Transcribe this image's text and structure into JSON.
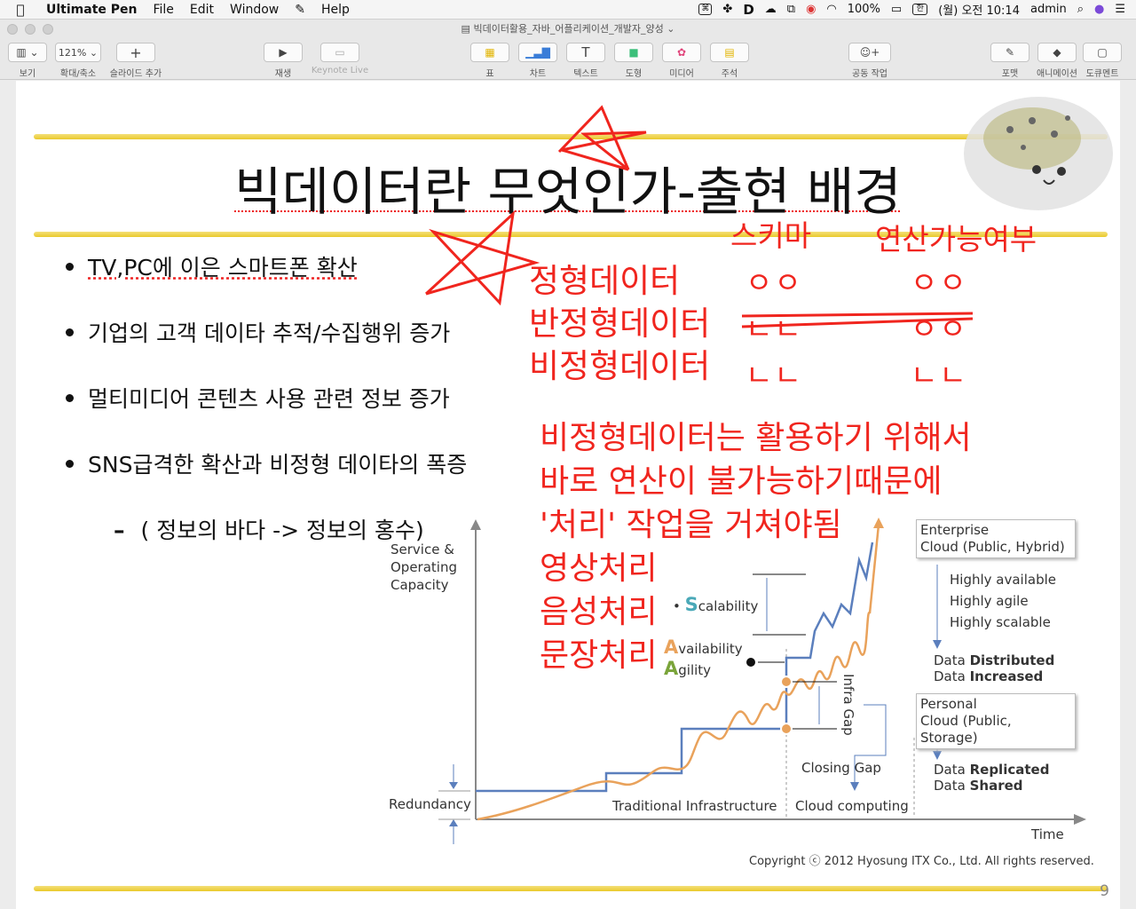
{
  "menubar": {
    "app_name": "Ultimate Pen",
    "menus": [
      "File",
      "Edit",
      "Window",
      "Help"
    ],
    "battery": "100%",
    "input_mode": "한",
    "clock": "(월) 오전 10:14",
    "user": "admin"
  },
  "window": {
    "title": "빅데이터활용_자바_어플리케이션_개발자_양성"
  },
  "toolbar": {
    "view_label": "보기",
    "zoom_value": "121%",
    "zoom_label": "확대/축소",
    "add_slide_label": "슬라이드 추가",
    "play_label": "재생",
    "keynote_live_label": "Keynote Live",
    "table_label": "표",
    "chart_label": "차트",
    "text_label": "텍스트",
    "shape_label": "도형",
    "media_label": "미디어",
    "comment_label": "주석",
    "collab_label": "공동 작업",
    "format_label": "포맷",
    "animate_label": "애니메이션",
    "document_label": "도큐멘트"
  },
  "slide": {
    "title": "빅데이터란 무엇인가-출현 배경",
    "bullets": [
      "TV,PC에 이은 스마트폰 확산",
      "기업의 고객 데이타 추적/수집행위 증가",
      "멀티미디어 콘텐츠 사용 관련 정보 증가",
      "SNS급격한 확산과 비정형 데이타의 폭증"
    ],
    "sub_bullet": "( 정보의 바다 -> 정보의 홍수)",
    "number": "9",
    "copyright": "Copyright ⓒ 2012 Hyosung ITX Co., Ltd. All rights reserved."
  },
  "annotations": {
    "header_schema": "스키마",
    "header_compute": "연산가능여부",
    "rows": [
      "정형데이터",
      "반정형데이터",
      "비정형데이터"
    ],
    "schema_marks": [
      "ㅇㅇ",
      "ㄴㄴ",
      "ㄴㄴ"
    ],
    "compute_marks": [
      "ㅇㅇ",
      "ㅇㅇ",
      "ㄴㄴ"
    ],
    "note_lines": [
      "비정형데이터는 활용하기 위해서",
      "바로 연산이 불가능하기때문에",
      "'처리' 작업을 거쳐야됨",
      "영상처리",
      "음성처리",
      "문장처리"
    ]
  },
  "diagram": {
    "y_label_lines": [
      "Service &",
      "Operating",
      "Capacity"
    ],
    "x_label": "Time",
    "redundancy": "Redundancy",
    "traditional": "Traditional Infrastructure",
    "cloud_computing": "Cloud computing",
    "closing_gap": "Closing Gap",
    "infra_gap": "Infra Gap",
    "scalability_rest": "calability",
    "scalability_initial": "S",
    "availability_initial": "A",
    "availability_rest": "vailability",
    "agility_initial": "A",
    "agility_rest": "gility",
    "enterprise_cloud_lines": [
      "Enterprise",
      "Cloud (Public, Hybrid)"
    ],
    "enterprise_traits": [
      "Highly available",
      "Highly agile",
      "Highly scalable"
    ],
    "distributed_prefix": "Data ",
    "distributed_bold": "Distributed",
    "increased_bold": "Increased",
    "personal_cloud_lines": [
      "Personal",
      "Cloud (Public, Storage)"
    ],
    "replicated_bold": "Replicated",
    "shared_bold": "Shared",
    "colors": {
      "blue": "#5b7fbd",
      "orange": "#e9a25b",
      "teal": "#4aa9b8",
      "green": "#7aa43a"
    }
  }
}
